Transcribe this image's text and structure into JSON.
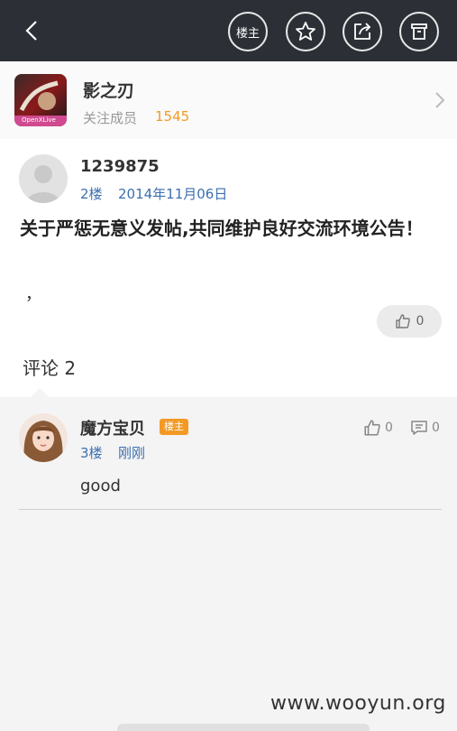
{
  "topbar": {
    "back_icon": "back-chevron-icon",
    "owner_label": "楼主",
    "buttons": [
      "star-icon",
      "share-icon",
      "delete-icon"
    ]
  },
  "forum": {
    "name": "影之刃",
    "follow_label": "关注成员",
    "follow_count": "1545",
    "logo_text": "OpenXLive"
  },
  "post": {
    "author": "1239875",
    "floor": "2楼",
    "date": "2014年11月06日",
    "title": "关于严惩无意义发帖,共同维护良好交流环境公告！",
    "body": "，",
    "likes": "0"
  },
  "comments": {
    "header": "评论 2",
    "items": [
      {
        "author": "魔方宝贝",
        "badge": "楼主",
        "floor": "3楼",
        "time": "刚刚",
        "likes": "0",
        "replies": "0",
        "text": "good"
      }
    ]
  },
  "watermark": "www.wooyun.org",
  "colors": {
    "topbar": "#2c3036",
    "accent_orange": "#f39a25",
    "link_blue": "#3c6fb0"
  }
}
